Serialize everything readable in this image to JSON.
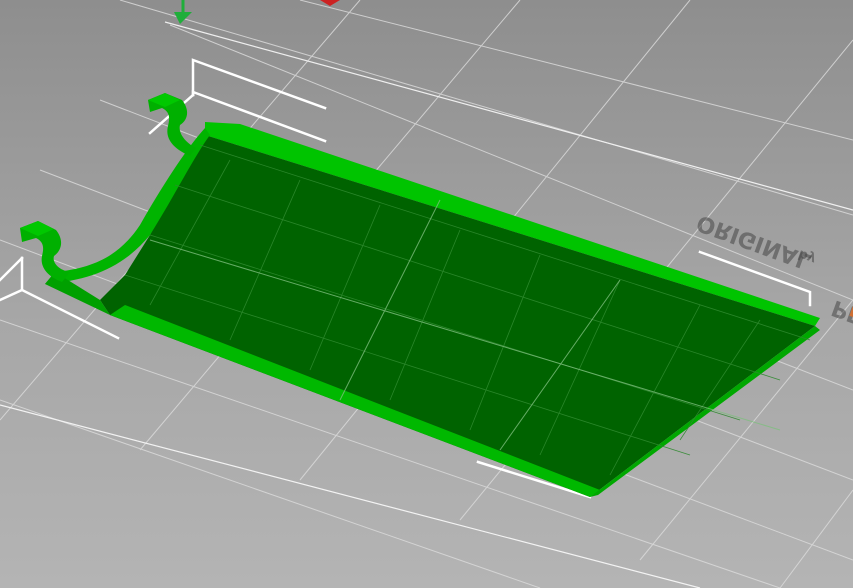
{
  "viewport": {
    "name": "3D print bed viewport",
    "background_top": "#8e8e8e",
    "background_bottom": "#b4b4b4"
  },
  "bed": {
    "logo_word_1": "ORIGINAL",
    "logo_word_2": "PRUSA",
    "logo_mark": "M",
    "logo_sub": "by",
    "grid_color": "#d9d9d9",
    "accent": "#e06a28"
  },
  "model": {
    "color_top": "#006400",
    "color_side": "#00b000",
    "color_highlight": "#00c800",
    "selected": true
  },
  "axes": {
    "y_axis_color": "#1fae3a",
    "x_axis_color": "#cc2222"
  }
}
